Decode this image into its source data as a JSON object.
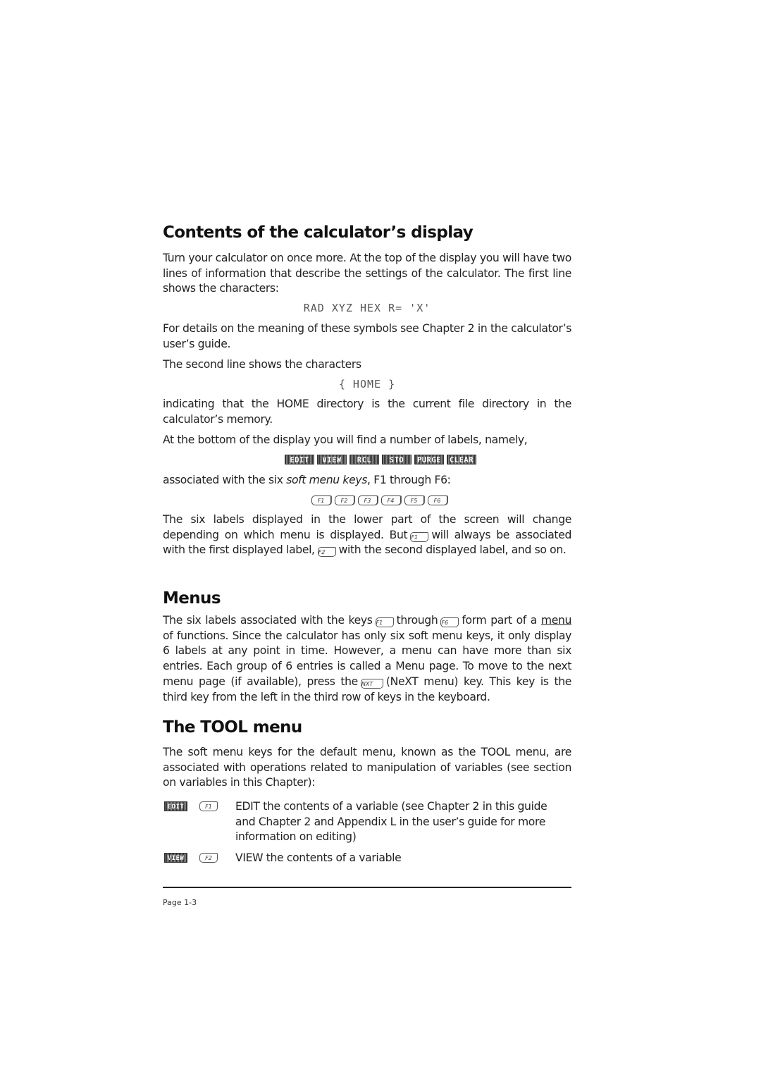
{
  "sections": {
    "display": {
      "heading": "Contents of the calculator’s display",
      "p1": "Turn your calculator on once more.  At the top of the display you will have two lines of information that describe the settings of the calculator.  The first line shows the characters:",
      "lcd_line1": "RAD XYZ HEX R= 'X'",
      "p2": "For details on the meaning of these symbols see Chapter 2 in the calculator’s user’s guide.",
      "p3": "The second line shows the characters",
      "lcd_line2": "{ HOME }",
      "p4": "indicating that the HOME directory is the current file directory in the calculator’s memory.",
      "p5": "At the bottom of the display you will find a number of labels, namely,",
      "soft_labels": [
        "EDIT",
        "VIEW",
        "RCL",
        "STO",
        "PURGE",
        "CLEAR"
      ],
      "p6_pre": "associated with the six ",
      "p6_em": "soft menu keys",
      "p6_post": ", F1 through F6:",
      "fkeys": [
        "F1",
        "F2",
        "F3",
        "F4",
        "F5",
        "F6"
      ],
      "p7_a": "The six labels displayed in the lower part of the screen will change depending on which menu is displayed.  But",
      "p7_key1": "F1",
      "p7_b": "will always be associated with the first displayed label,",
      "p7_key2": "F2",
      "p7_c": "with the second displayed label, and so on."
    },
    "menus": {
      "heading": "Menus",
      "p_a": "The six labels associated with the keys",
      "key_first": "F1",
      "p_b": "through",
      "key_last": "F6",
      "p_c": "form part of a",
      "underlined": "menu",
      "p_d": "of functions.  Since the calculator has only six soft menu keys, it only display 6 labels at any point in time.  However, a menu can have more than six entries.  Each group of 6 entries is called a Menu page.  To move to the next menu page (if available), press the",
      "key_next": "NXT",
      "p_e": "(NeXT menu) key.  This key is the third key from the left in the third row of keys in the keyboard."
    },
    "tool": {
      "heading": "The TOOL menu",
      "p1": "The soft menu keys for the default menu, known as the TOOL menu, are associated with operations related to manipulation of variables (see section on variables in this Chapter):",
      "items": [
        {
          "label": "EDIT",
          "key": "F1",
          "description": "EDIT the contents of a variable (see Chapter 2 in this guide and Chapter 2 and Appendix L in the user’s guide for more information on editing)"
        },
        {
          "label": "VIEW",
          "key": "F2",
          "description": "VIEW the contents of a variable"
        }
      ]
    }
  },
  "footer": {
    "page_label": "Page 1-3"
  }
}
